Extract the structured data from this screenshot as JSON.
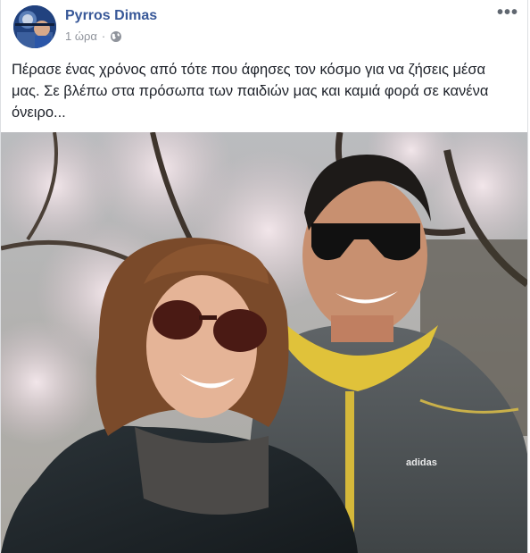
{
  "post": {
    "author": "Pyrros Dimas",
    "timestamp": "1 ώρα",
    "separator": "·",
    "privacy_icon": "globe-icon",
    "more_icon": "more-options-icon",
    "more_label": "•••",
    "text": "Πέρασε ένας χρόνος από τότε που άφησες τον κόσμο για να ζήσεις μέσα μας. Σε βλέπω στα πρόσωπα των παιδιών μας και καμιά φορά σε κανένα όνειρο...",
    "photo": {
      "logo_text": "adidas"
    }
  },
  "colors": {
    "author_link": "#385898",
    "meta_text": "#90949c",
    "body_text": "#1d2129"
  }
}
